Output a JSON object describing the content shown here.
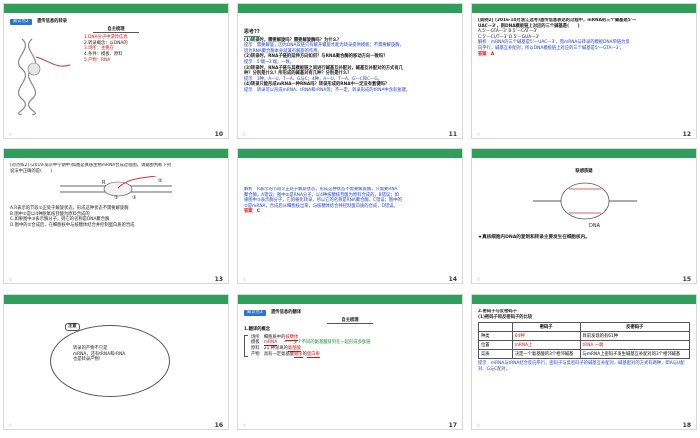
{
  "slides": [
    {
      "page": "10",
      "badge": "知识点2",
      "heading": "遗传信息的转录",
      "subheading": "自主梳理",
      "lines": [
        "1.DNA分子中遗传信息",
        "2.转录概念：以DNA的",
        "3.场所：主要在",
        "4.条件：模板、原料",
        "5.产物：RNA"
      ]
    },
    {
      "page": "11",
      "heading": "思考??",
      "lines": [
        {
          "text": "(1)转录时，需要解旋吗？需要解旋酶吗？为什么？",
          "cls": "strong"
        },
        {
          "text": "提示　需要解旋，因为DNA双链只有解开螺旋才能为转录提供模板；不需要解旋酶，",
          "cls": "b"
        },
        {
          "text": "因为RNA聚合酶本身就兼有解旋的作用。",
          "cls": "b"
        },
        {
          "text": "(2)转录时，RNA子链的延伸方向如何？与RNA聚合酶的移动方向一致吗？",
          "cls": "strong"
        },
        {
          "text": "提示　5'端→3'端，一致。",
          "cls": "b"
        },
        {
          "text": "(3)转录时，RNA子链与其模板链之间进行碱基互补配对，碱基互补配对的方式有几",
          "cls": "strong"
        },
        {
          "text": "种？分别是什么？所形成的碱基对有几种？分别是什么？",
          "cls": "strong"
        },
        {
          "text": "提示　3种，A—U、T—A、G与C；4种，A—U、T—A、G—C和C—G。",
          "cls": "b"
        },
        {
          "text": "(4)转录只能形成mRNA一种RNA吗？转录形成的RNA中一定没有氢键吗？",
          "cls": "strong"
        },
        {
          "text": "提示　转录可以形成mRNA、tRNA和rRNA等；不一定，转录形成的tRNA中含有氢键。",
          "cls": "b"
        }
      ]
    },
    {
      "page": "12",
      "lines": [
        {
          "text": "[典例2] (2016·10月浙江选考)遗传信息表达的过程中，mRNA的三个碱基是5'—",
          "cls": "strong"
        },
        {
          "text": "UAC—3'，则DNA模板链上对应的三个碱基是(　　)",
          "cls": "strong"
        },
        {
          "text": "A.5'—GTA—3'  B.5'—CAT—3'",
          "cls": ""
        },
        {
          "text": "C.5'—CUT—3'  D.5'—GUA—3'",
          "cls": ""
        },
        {
          "text": "解析　mRNA的三个碱基是5'—UAC—3'，而mRNA与转录的模板DNA单链为反",
          "cls": "b"
        },
        {
          "text": "向平行，碱基互补配对，所以DNA模板链上对应的三个碱基是5'—GTA—3'。",
          "cls": "b"
        },
        {
          "text": "答案　A",
          "cls": "r"
        }
      ]
    },
    {
      "page": "13",
      "lines": [
        {
          "text": "[对点练2] (2019·南京中学期中)如图是真核生物mRNA合成过程图，请据图判断下列",
          "cls": ""
        },
        {
          "text": "说法中正确的是(　　)",
          "cls": ""
        },
        {
          "text": "A.R表示的节段①正处于解旋状态，形成这种状态不需要解旋酶",
          "cls": ""
        },
        {
          "text": "B.图中②是以4种脱氧核苷酸为原料合成的",
          "cls": ""
        },
        {
          "text": "C.如果图中③表示酶分子，则它的名称是DNA聚合酶",
          "cls": ""
        },
        {
          "text": "D.图中的②合成后，在细胞核中与核糖体结合并控制蛋白质的合成",
          "cls": ""
        }
      ],
      "figure": {
        "R": "R",
        "n1": "①",
        "n2": "②",
        "n3": "③"
      }
    },
    {
      "page": "14",
      "lines": [
        {
          "text": "解析　R表示的节段①正处于解旋状态，形成这种状态不需要解旋酶，只需要RNA",
          "cls": "b"
        },
        {
          "text": "聚合酶，A错误；图中②是RNA分子，以4种核糖核苷酸为原料合成的，B错误；如",
          "cls": "b"
        },
        {
          "text": "果图中③表示酶分子，它的催化转录，所以它的名称是RNA聚合酶，C错误；图中的",
          "cls": "b"
        },
        {
          "text": "②是mRNA，合成后从细胞核出来，与核糖体结合并控制蛋白质的合成，D错误。",
          "cls": "b"
        },
        {
          "text": "答案　C",
          "cls": "r"
        }
      ]
    },
    {
      "page": "15",
      "heading": "联想质疑",
      "label": "DNA",
      "caption": "★真核细胞内DNA的复制和转录主要发生在细胞核内。"
    },
    {
      "page": "16",
      "note_title": "注意",
      "note_lines": [
        "转录的产物不只是",
        "mRNA，还有tRNA和rRNA",
        "也是转录产物！"
      ]
    },
    {
      "page": "17",
      "badge": "知识点3",
      "heading": "遗传信息的翻译",
      "subheading": "自主梳理",
      "section": "1.翻译的概念",
      "rows": [
        {
          "k": "场所",
          "v": "细胞质中的",
          "a": "核糖体"
        },
        {
          "k": "模板",
          "v": "",
          "a": "mRNA"
        },
        {
          "k": "原料",
          "v": "21 种游离的",
          "a": "氨基酸"
        },
        {
          "k": "产物",
          "v": "具有一定氨基酸",
          "a": "顺序",
          "a2": "蛋白质"
        }
      ],
      "aside": "—— 多个不同的氨基酸排列在一起形成多肽链"
    },
    {
      "page": "18",
      "title": "2.密码子与反密码子",
      "subtitle": "(1)密码子和反密码子的比较",
      "table": {
        "headers": [
          "",
          "密码子",
          "反密码子"
        ],
        "rows": [
          [
            "种类",
            "64种",
            "目前发现的有61种"
          ],
          [
            "位置",
            "mRNA上",
            "tRNA 一端"
          ],
          [
            "实质",
            "决定一个氨基酸的3个相邻碱基",
            "与mRNA上密码子发生碱基互补配对的3个相邻碱基"
          ]
        ]
      },
      "note": "提示　mRNA与tRNA结合反向平行，密码子与反密码子的碱基互补配对，碱基配对的方式有两种，即A与U配对、G与C配对。"
    }
  ]
}
